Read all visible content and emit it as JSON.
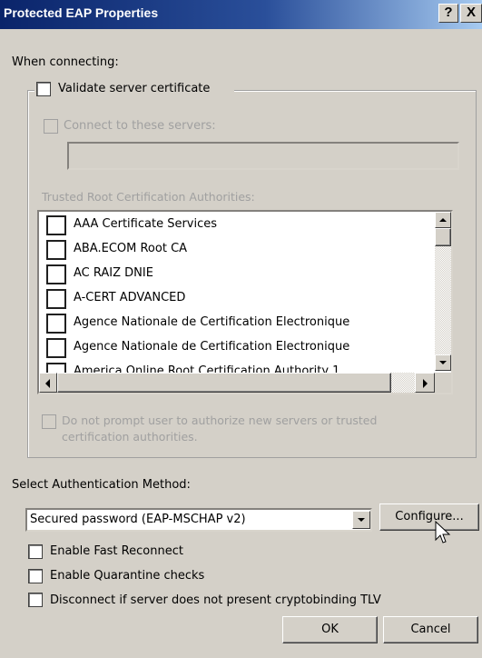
{
  "window": {
    "title": "Protected EAP Properties",
    "help_label": "?",
    "close_label": "X"
  },
  "when_connecting_label": "When connecting:",
  "validate_server_certificate": {
    "label": "Validate server certificate",
    "checked": false
  },
  "connect_to_servers": {
    "label": "Connect to these servers:",
    "checked": false,
    "value": ""
  },
  "trusted_roots_label": "Trusted Root Certification Authorities:",
  "trusted_roots": [
    "AAA Certificate Services",
    "ABA.ECOM Root CA",
    "AC RAIZ DNIE",
    "A-CERT ADVANCED",
    "Agence Nationale de Certification Electronique",
    "Agence Nationale de Certification Electronique",
    "America Online Root Certification Authority 1"
  ],
  "do_not_prompt": {
    "label_line1": "Do not prompt user to authorize new servers or trusted",
    "label_line2": "certification authorities.",
    "checked": false
  },
  "auth_method": {
    "label": "Select Authentication Method:",
    "selected": "Secured password (EAP-MSCHAP v2)",
    "configure_label": "Configure..."
  },
  "options": [
    {
      "label": "Enable Fast Reconnect",
      "checked": false
    },
    {
      "label": "Enable Quarantine checks",
      "checked": false
    },
    {
      "label": "Disconnect if server does not present cryptobinding TLV",
      "checked": false
    }
  ],
  "buttons": {
    "ok": "OK",
    "cancel": "Cancel"
  }
}
